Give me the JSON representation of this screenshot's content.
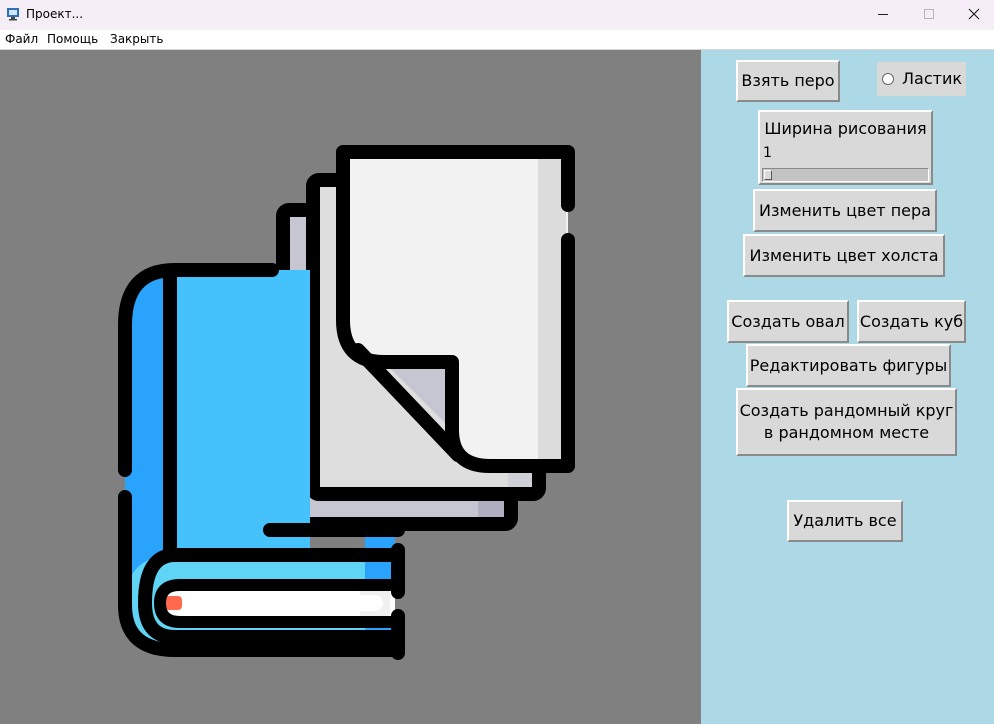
{
  "window": {
    "title": "Проект...",
    "controls": {
      "minimize": "minimize-icon",
      "maximize": "maximize-icon",
      "close": "close-icon"
    }
  },
  "menu": {
    "file": "Файл",
    "help": "Помощь",
    "close": "Закрыть"
  },
  "canvas": {
    "background": "#808080"
  },
  "panel": {
    "background": "#add8e6",
    "pen_button": "Взять перо",
    "eraser_label": "Ластик",
    "eraser_selected": false,
    "width_label": "Ширина рисования",
    "width_value": "1",
    "pen_color_button": "Изменить цвет пера",
    "canvas_color_button": "Изменить цвет холста",
    "oval_button": "Создать овал",
    "cube_button": "Создать куб",
    "edit_button": "Редактировать фигуры",
    "random_circle_button": "Создать рандомный круг\nв рандомном месте",
    "delete_button": "Удалить все"
  },
  "colors": {
    "button_bg": "#d9d9d9",
    "book_dark_blue": "#29a3fb",
    "book_blue": "#45c1fb",
    "book_cyan": "#5fd4f5",
    "page_light": "#f2f2f2",
    "page_mid": "#dedede",
    "page_dark": "#c6c6d2"
  }
}
